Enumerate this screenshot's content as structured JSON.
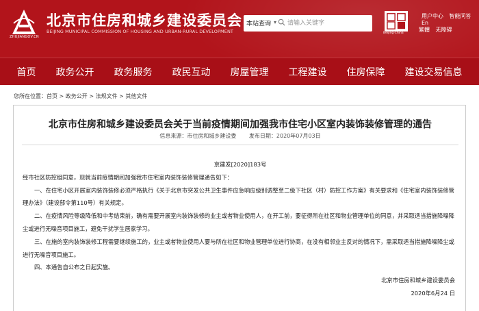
{
  "header": {
    "logo_caption": "ZHUJIANGOV.CN",
    "site_title": "北京市住房和城乡建设委员会",
    "site_subtitle": "BEIJING MUNICIPAL COMMISSION OF HOUSING AND URBAN-RURAL DEVELOPMENT",
    "search_scope": "本站查询",
    "search_placeholder": "请输入关键字",
    "beijing_logo_caption": "Beijing·China",
    "top_links_row1": [
      "用户中心",
      "智能问答",
      "En"
    ],
    "top_links_row2": [
      "繁體",
      "无障碍"
    ]
  },
  "nav": {
    "items": [
      "首页",
      "政务公开",
      "政务服务",
      "政民互动",
      "房屋管理",
      "工程建设",
      "住房保障",
      "建设交易信息"
    ]
  },
  "breadcrumb": {
    "prefix": "您所在位置：",
    "items": [
      "首页",
      "政务公开",
      "法规文件",
      "其他文件"
    ],
    "separator": " > "
  },
  "article": {
    "title": "北京市住房和城乡建设委员会关于当前疫情期间加强我市住宅小区室内装饰装修管理的通告",
    "source": "信息来源：市住房和城乡建设委",
    "date": "发布日期：2020年07月03日",
    "doc_number": "京建发[2020]183号",
    "intro": "经市社区防控组同意，现就当前疫情期间加强我市住宅室内装饰装修管理通告如下：",
    "items": [
      "一、在住宅小区开展室内装饰装修必须严格执行《关于北京市突发公共卫生事件应急响应级别调整至二级下社区（村）防控工作方案》有关要求和《住宅室内装饰装修管理办法》（建设部令第110号）有关规定。",
      "二、在疫情风险等级降低和中考结束前，确有需要开展室内装饰装修的业主或者物业使用人，在开工前，要征得所在社区和物业管理单位的同意，并采取适当措施降噪降尘或进行无噪音项目施工，避免干扰学生居家学习。",
      "三、在施的室内装饰装修工程需要继续施工的，业主或者物业使用人要与所在社区和物业管理单位进行协商，在没有相邻业主反对的情况下，需采取适当措施降噪降尘或进行无噪音项目施工。",
      "四、本通告自公布之日起实施。"
    ],
    "signature": "北京市住房和城乡建设委员会",
    "sign_date": "2020年6月24 日"
  }
}
